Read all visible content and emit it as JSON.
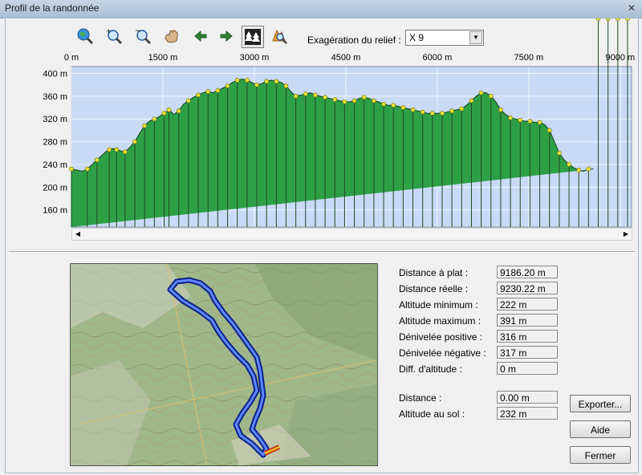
{
  "window": {
    "title": "Profil de la randonnée"
  },
  "toolbar": {
    "icons": [
      "zoom-globe-icon",
      "zoom-in-icon",
      "zoom-out-icon",
      "pan-hand-icon",
      "arrow-left-icon",
      "arrow-right-icon",
      "trees-icon",
      "map-zoom-icon"
    ],
    "exaggeration_label": "Exagération du relief :",
    "exaggeration_value": "X 9"
  },
  "chart_data": {
    "type": "area",
    "x_ticks": [
      "0 m",
      "1500 m",
      "3000 m",
      "4500 m",
      "6000 m",
      "7500 m",
      "9000 m"
    ],
    "x_tick_values": [
      0,
      1500,
      3000,
      4500,
      6000,
      7500,
      9000
    ],
    "y_ticks": [
      "400 m",
      "360 m",
      "320 m",
      "280 m",
      "240 m",
      "200 m",
      "160 m"
    ],
    "y_tick_values": [
      400,
      360,
      320,
      280,
      240,
      200,
      160
    ],
    "xlim": [
      0,
      9186
    ],
    "ylim": [
      130,
      412
    ],
    "colors": {
      "sky": "#c9daf7",
      "fill": "#2da046",
      "outline": "#0f3d17",
      "marker": "#e8e235",
      "bars": "#1e4a22"
    },
    "x": [
      0,
      100,
      180,
      260,
      340,
      420,
      500,
      560,
      620,
      680,
      740,
      800,
      880,
      960,
      1040,
      1120,
      1200,
      1280,
      1360,
      1440,
      1520,
      1600,
      1680,
      1760,
      1840,
      1920,
      2000,
      2080,
      2160,
      2240,
      2320,
      2400,
      2480,
      2560,
      2640,
      2720,
      2800,
      2880,
      2960,
      3040,
      3120,
      3200,
      3280,
      3360,
      3440,
      3520,
      3600,
      3680,
      3760,
      3840,
      3920,
      4000,
      4080,
      4160,
      4240,
      4320,
      4400,
      4480,
      4560,
      4640,
      4720,
      4800,
      4880,
      4960,
      5040,
      5120,
      5200,
      5280,
      5360,
      5440,
      5520,
      5600,
      5680,
      5760,
      5840,
      5920,
      6000,
      6080,
      6160,
      6240,
      6320,
      6400,
      6480,
      6560,
      6640,
      6720,
      6800,
      6880,
      6960,
      7040,
      7120,
      7200,
      7280,
      7360,
      7440,
      7520,
      7600,
      7680,
      7760,
      7840,
      7920,
      8000,
      8080,
      8160,
      8240,
      8320,
      8400,
      8480,
      8560,
      8640,
      8720,
      8800,
      8880,
      8960,
      9040,
      9120,
      9186
    ],
    "y": [
      232,
      230,
      228,
      232,
      240,
      248,
      256,
      262,
      266,
      268,
      266,
      264,
      262,
      270,
      280,
      295,
      308,
      316,
      320,
      324,
      330,
      336,
      328,
      334,
      346,
      352,
      358,
      362,
      366,
      368,
      366,
      370,
      374,
      378,
      384,
      388,
      390,
      388,
      384,
      380,
      382,
      386,
      388,
      386,
      384,
      378,
      368,
      360,
      362,
      364,
      366,
      362,
      360,
      358,
      356,
      354,
      352,
      350,
      350,
      352,
      356,
      358,
      356,
      352,
      350,
      346,
      344,
      344,
      342,
      340,
      338,
      336,
      334,
      332,
      330,
      330,
      330,
      330,
      332,
      334,
      336,
      338,
      344,
      352,
      360,
      366,
      366,
      360,
      350,
      336,
      328,
      322,
      320,
      318,
      316,
      316,
      314,
      314,
      310,
      300,
      280,
      260,
      248,
      240,
      234,
      230,
      228,
      232,
      232
    ],
    "markers_x": [
      0,
      260,
      420,
      620,
      740,
      880,
      1040,
      1200,
      1360,
      1520,
      1600,
      1760,
      1920,
      2080,
      2240,
      2400,
      2560,
      2720,
      2880,
      3040,
      3200,
      3360,
      3520,
      3680,
      3840,
      4000,
      4160,
      4320,
      4480,
      4640,
      4800,
      4960,
      5120,
      5280,
      5440,
      5600,
      5760,
      5920,
      6080,
      6240,
      6400,
      6560,
      6720,
      6880,
      7040,
      7200,
      7360,
      7520,
      7680,
      7840,
      8000,
      8160,
      8320,
      8480,
      8640,
      8800,
      8960,
      9120
    ]
  },
  "stats": [
    {
      "label": "Distance à plat :",
      "value": "9186.20 m"
    },
    {
      "label": "Distance réelle :",
      "value": "9230.22 m"
    },
    {
      "label": "Altitude minimum :",
      "value": "222 m"
    },
    {
      "label": "Altitude maximum :",
      "value": "391 m"
    },
    {
      "label": "Dénivelée positive :",
      "value": "316 m"
    },
    {
      "label": "Dénivelée négative :",
      "value": "317 m"
    },
    {
      "label": "Diff. d'altitude :",
      "value": "0 m"
    }
  ],
  "cursor": [
    {
      "label": "Distance :",
      "value": "0.00 m"
    },
    {
      "label": "Altitude au sol :",
      "value": "232 m"
    }
  ],
  "buttons": {
    "export": "Exporter...",
    "help": "Aide",
    "close": "Fermer"
  },
  "map": {
    "track_color": "#1533d6",
    "start_color": "#f0c020"
  }
}
